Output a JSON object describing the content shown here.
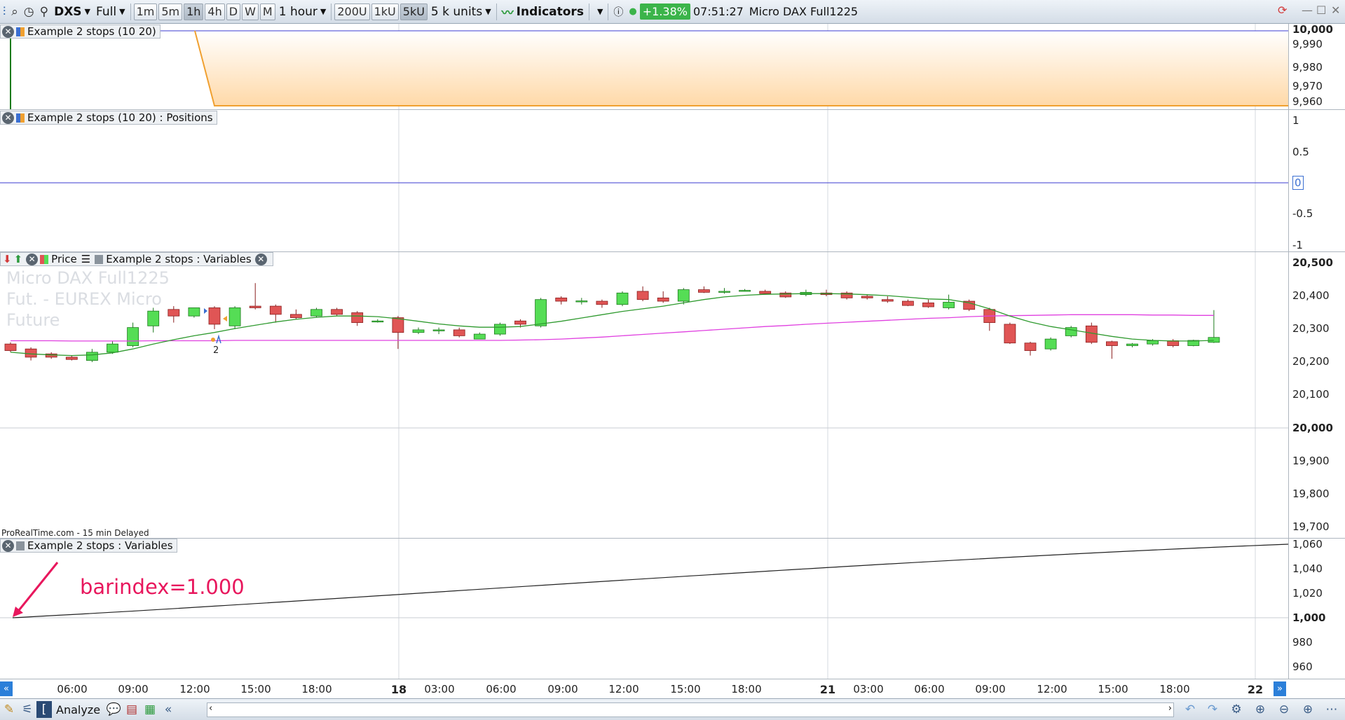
{
  "toolbar": {
    "instrument_code": "DXS",
    "view_mode": "Full",
    "timeframe_buttons": [
      "1m",
      "5m",
      "1h",
      "4h",
      "D",
      "W",
      "M"
    ],
    "active_timeframe": "1h",
    "timeframe_select": "1 hour",
    "unit_buttons": [
      "200U",
      "1kU",
      "5kU"
    ],
    "active_unit": "5kU",
    "units_select": "5 k units",
    "indicators_label": "Indicators",
    "variation": "+1.38%",
    "clock": "07:51:27",
    "instrument_name": "Micro DAX Full1225",
    "colors": {
      "variation_bg": "#3bb44a"
    }
  },
  "panels": {
    "equity": {
      "title": "Example 2 stops (10 20)",
      "axis_labels": [
        "10,000",
        "9,990",
        "9,980",
        "9,970",
        "9,960"
      ]
    },
    "positions": {
      "title": "Example 2 stops (10 20) : Positions",
      "axis_labels": [
        "1",
        "0.5",
        "0",
        "-0.5",
        "-1"
      ]
    },
    "price": {
      "price_label": "Price",
      "variables_label": "Example 2 stops : Variables",
      "watermark": [
        "Micro DAX Full1225",
        "Fut. - EUREX Micro",
        "Future"
      ],
      "trade_count": "2",
      "axis_labels": [
        "20,500",
        "20,400",
        "20,300",
        "20,200",
        "20,100",
        "20,000",
        "19,900",
        "19,800",
        "19,700"
      ],
      "source_note": "ProRealTime.com - 15 min Delayed",
      "colors": {
        "bull": "#55dd55",
        "bear": "#e05555",
        "ma_fast": "#2f9a2f",
        "ma_slow": "#e040e0"
      }
    },
    "barindex": {
      "title": "Example 2 stops : Variables",
      "annotation": "barindex=1.000",
      "axis_labels": [
        "1,060",
        "1,040",
        "1,020",
        "1,000",
        "980",
        "960"
      ],
      "colors": {
        "annotation": "#e8175d"
      }
    }
  },
  "time_axis": {
    "labels": [
      "06:00",
      "09:00",
      "12:00",
      "15:00",
      "18:00",
      "18",
      "03:00",
      "06:00",
      "09:00",
      "12:00",
      "15:00",
      "18:00",
      "21",
      "03:00",
      "06:00",
      "09:00",
      "12:00",
      "15:00",
      "18:00",
      "22"
    ]
  },
  "statusbar": {
    "analyze_label": "Analyze"
  },
  "chart_data": {
    "type": "candlestick",
    "ylim": [
      19650,
      20520
    ],
    "candles": [
      {
        "o": 20255,
        "h": 20260,
        "l": 20230,
        "c": 20235
      },
      {
        "o": 20240,
        "h": 20245,
        "l": 20205,
        "c": 20215
      },
      {
        "o": 20225,
        "h": 20230,
        "l": 20210,
        "c": 20215
      },
      {
        "o": 20215,
        "h": 20220,
        "l": 20205,
        "c": 20208
      },
      {
        "o": 20205,
        "h": 20240,
        "l": 20200,
        "c": 20230
      },
      {
        "o": 20230,
        "h": 20265,
        "l": 20225,
        "c": 20255
      },
      {
        "o": 20250,
        "h": 20320,
        "l": 20245,
        "c": 20305
      },
      {
        "o": 20310,
        "h": 20365,
        "l": 20290,
        "c": 20355
      },
      {
        "o": 20360,
        "h": 20370,
        "l": 20320,
        "c": 20340
      },
      {
        "o": 20340,
        "h": 20365,
        "l": 20335,
        "c": 20365
      },
      {
        "o": 20365,
        "h": 20370,
        "l": 20300,
        "c": 20315
      },
      {
        "o": 20310,
        "h": 20370,
        "l": 20300,
        "c": 20365
      },
      {
        "o": 20370,
        "h": 20440,
        "l": 20360,
        "c": 20365
      },
      {
        "o": 20370,
        "h": 20375,
        "l": 20320,
        "c": 20345
      },
      {
        "o": 20345,
        "h": 20360,
        "l": 20330,
        "c": 20335
      },
      {
        "o": 20340,
        "h": 20365,
        "l": 20335,
        "c": 20360
      },
      {
        "o": 20360,
        "h": 20365,
        "l": 20340,
        "c": 20345
      },
      {
        "o": 20350,
        "h": 20355,
        "l": 20310,
        "c": 20320
      },
      {
        "o": 20325,
        "h": 20330,
        "l": 20320,
        "c": 20325
      },
      {
        "o": 20335,
        "h": 20340,
        "l": 20240,
        "c": 20290
      },
      {
        "o": 20290,
        "h": 20305,
        "l": 20285,
        "c": 20298
      },
      {
        "o": 20295,
        "h": 20305,
        "l": 20285,
        "c": 20298
      },
      {
        "o": 20298,
        "h": 20305,
        "l": 20275,
        "c": 20280
      },
      {
        "o": 20270,
        "h": 20290,
        "l": 20270,
        "c": 20285
      },
      {
        "o": 20285,
        "h": 20320,
        "l": 20280,
        "c": 20315
      },
      {
        "o": 20325,
        "h": 20330,
        "l": 20305,
        "c": 20315
      },
      {
        "o": 20310,
        "h": 20395,
        "l": 20305,
        "c": 20390
      },
      {
        "o": 20395,
        "h": 20400,
        "l": 20375,
        "c": 20385
      },
      {
        "o": 20385,
        "h": 20395,
        "l": 20375,
        "c": 20386
      },
      {
        "o": 20385,
        "h": 20390,
        "l": 20365,
        "c": 20375
      },
      {
        "o": 20375,
        "h": 20415,
        "l": 20370,
        "c": 20410
      },
      {
        "o": 20415,
        "h": 20430,
        "l": 20385,
        "c": 20390
      },
      {
        "o": 20395,
        "h": 20415,
        "l": 20380,
        "c": 20385
      },
      {
        "o": 20385,
        "h": 20425,
        "l": 20375,
        "c": 20420
      },
      {
        "o": 20420,
        "h": 20430,
        "l": 20410,
        "c": 20412
      },
      {
        "o": 20412,
        "h": 20425,
        "l": 20408,
        "c": 20415
      },
      {
        "o": 20418,
        "h": 20422,
        "l": 20414,
        "c": 20418
      },
      {
        "o": 20415,
        "h": 20420,
        "l": 20405,
        "c": 20408
      },
      {
        "o": 20410,
        "h": 20415,
        "l": 20395,
        "c": 20398
      },
      {
        "o": 20405,
        "h": 20420,
        "l": 20400,
        "c": 20412
      },
      {
        "o": 20410,
        "h": 20420,
        "l": 20400,
        "c": 20405
      },
      {
        "o": 20410,
        "h": 20415,
        "l": 20390,
        "c": 20395
      },
      {
        "o": 20400,
        "h": 20405,
        "l": 20390,
        "c": 20395
      },
      {
        "o": 20390,
        "h": 20400,
        "l": 20380,
        "c": 20385
      },
      {
        "o": 20385,
        "h": 20390,
        "l": 20370,
        "c": 20372
      },
      {
        "o": 20380,
        "h": 20390,
        "l": 20365,
        "c": 20368
      },
      {
        "o": 20365,
        "h": 20405,
        "l": 20360,
        "c": 20382
      },
      {
        "o": 20385,
        "h": 20390,
        "l": 20355,
        "c": 20360
      },
      {
        "o": 20360,
        "h": 20365,
        "l": 20295,
        "c": 20320
      },
      {
        "o": 20315,
        "h": 20320,
        "l": 20255,
        "c": 20258
      },
      {
        "o": 20258,
        "h": 20262,
        "l": 20220,
        "c": 20235
      },
      {
        "o": 20240,
        "h": 20275,
        "l": 20235,
        "c": 20270
      },
      {
        "o": 20280,
        "h": 20310,
        "l": 20275,
        "c": 20305
      },
      {
        "o": 20310,
        "h": 20320,
        "l": 20255,
        "c": 20260
      },
      {
        "o": 20262,
        "h": 20265,
        "l": 20210,
        "c": 20250
      },
      {
        "o": 20250,
        "h": 20258,
        "l": 20245,
        "c": 20255
      },
      {
        "o": 20255,
        "h": 20270,
        "l": 20250,
        "c": 20265
      },
      {
        "o": 20265,
        "h": 20270,
        "l": 20245,
        "c": 20250
      },
      {
        "o": 20250,
        "h": 20268,
        "l": 20248,
        "c": 20266
      },
      {
        "o": 20260,
        "h": 20358,
        "l": 20258,
        "c": 20275
      }
    ],
    "ma_fast": [
      20230,
      20225,
      20222,
      20220,
      20222,
      20228,
      20240,
      20255,
      20268,
      20280,
      20290,
      20302,
      20312,
      20322,
      20330,
      20336,
      20340,
      20340,
      20338,
      20332,
      20324,
      20316,
      20310,
      20306,
      20306,
      20308,
      20316,
      20324,
      20334,
      20344,
      20354,
      20362,
      20370,
      20380,
      20390,
      20398,
      20403,
      20406,
      20407,
      20408,
      20408,
      20407,
      20405,
      20402,
      20397,
      20392,
      20390,
      20380,
      20362,
      20340,
      20322,
      20308,
      20298,
      20288,
      20278,
      20270,
      20266,
      20264,
      20264,
      20266
    ],
    "ma_slow": [
      20265,
      20265,
      20265,
      20264,
      20264,
      20264,
      20264,
      20265,
      20265,
      20265,
      20265,
      20266,
      20266,
      20266,
      20266,
      20266,
      20266,
      20266,
      20266,
      20266,
      20266,
      20266,
      20266,
      20266,
      20266,
      20267,
      20268,
      20270,
      20273,
      20276,
      20280,
      20284,
      20288,
      20292,
      20296,
      20300,
      20304,
      20308,
      20311,
      20315,
      20318,
      20321,
      20324,
      20327,
      20330,
      20333,
      20335,
      20338,
      20340,
      20341,
      20342,
      20343,
      20344,
      20344,
      20344,
      20344,
      20343,
      20343,
      20342,
      20342
    ],
    "barindex_values": [
      1000,
      1060
    ],
    "equity_values": [
      10000,
      9960
    ]
  }
}
